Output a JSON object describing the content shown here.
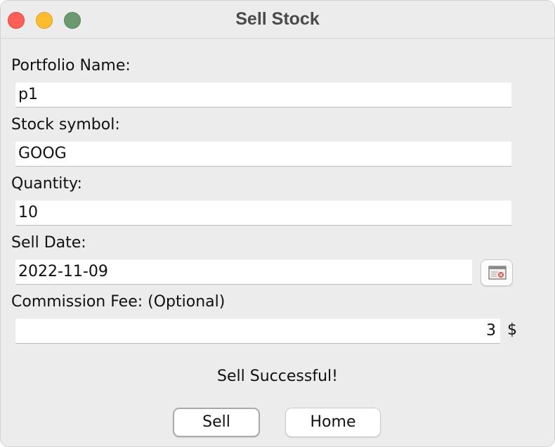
{
  "window": {
    "title": "Sell Stock"
  },
  "form": {
    "portfolio_label": "Portfolio Name:",
    "portfolio_value": "p1",
    "symbol_label": "Stock symbol:",
    "symbol_value": "GOOG",
    "quantity_label": "Quantity:",
    "quantity_value": "10",
    "date_label": "Sell Date:",
    "date_value": "2022-11-09",
    "fee_label": "Commission Fee: (Optional)",
    "fee_value": "3",
    "fee_unit": "$"
  },
  "status": {
    "message": "Sell Successful!"
  },
  "buttons": {
    "sell_label": "Sell",
    "home_label": "Home"
  },
  "icons": {
    "calendar": "calendar-icon"
  },
  "colors": {
    "close": "#fe5f57",
    "minimize": "#febc2e",
    "zoom": "#6a9a6e"
  }
}
